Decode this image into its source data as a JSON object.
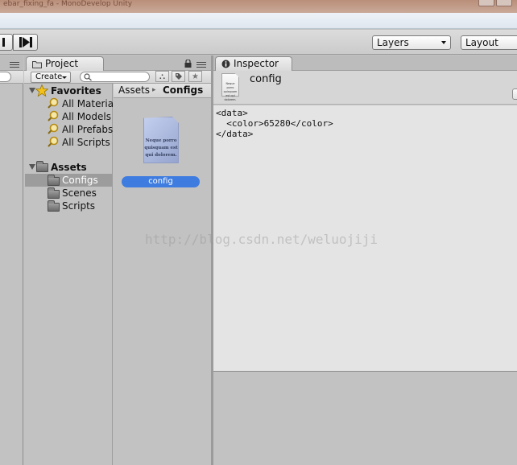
{
  "window": {
    "titlebar_text": "ebar_fixing_fa - MonoDevelop Unity",
    "colors": {
      "accent": "#3e7ce0",
      "panel": "#c2c2c2",
      "inspector_bg": "#e4e4e4"
    }
  },
  "toolbar": {
    "pause_icon": "pause-icon",
    "step_icon": "step-icon",
    "layers_label": "Layers",
    "layout_label": "Layout"
  },
  "project": {
    "tab_label": "Project",
    "create_label": "Create",
    "search_placeholder": "",
    "favorites": {
      "label": "Favorites",
      "items": [
        "All Material",
        "All Models",
        "All Prefabs",
        "All Scripts"
      ]
    },
    "assets": {
      "label": "Assets",
      "folders": [
        "Configs",
        "Scenes",
        "Scripts"
      ],
      "selected": "Configs"
    },
    "breadcrumb": {
      "root": "Assets",
      "separator": "▸",
      "current": "Configs"
    },
    "file": {
      "name": "config",
      "thumb_text": "Neque porro quisquam est qui dolorem."
    }
  },
  "inspector": {
    "tab_label": "Inspector",
    "object_name": "config",
    "icon_text": "Neque porro quisquam est qui dolorem.",
    "content": "<data>\n  <color>65280</color>\n</data>"
  },
  "watermark": "http://blog.csdn.net/weluojiji"
}
